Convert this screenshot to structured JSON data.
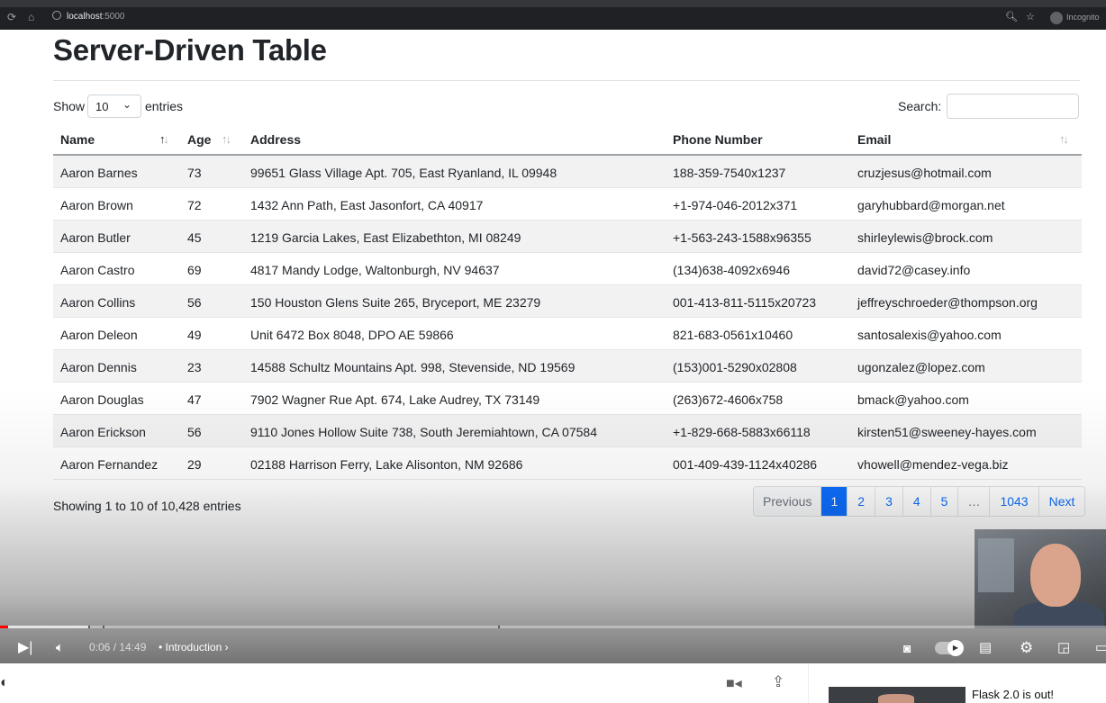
{
  "browser": {
    "url_host": "localhost",
    "url_port": ":5000",
    "incognito_label": "Incognito"
  },
  "page": {
    "title": "Server-Driven Table",
    "show_label": "Show",
    "page_size": "10",
    "entries_label": "entries",
    "search_label": "Search:",
    "search_value": ""
  },
  "table": {
    "columns": [
      "Name",
      "Age",
      "Address",
      "Phone Number",
      "Email"
    ],
    "sorted_column": "Name",
    "rows": [
      {
        "name": "Aaron Barnes",
        "age": "73",
        "address": "99651 Glass Village Apt. 705, East Ryanland, IL 09948",
        "phone": "188-359-7540x1237",
        "email": "cruzjesus@hotmail.com"
      },
      {
        "name": "Aaron Brown",
        "age": "72",
        "address": "1432 Ann Path, East Jasonfort, CA 40917",
        "phone": "+1-974-046-2012x371",
        "email": "garyhubbard@morgan.net"
      },
      {
        "name": "Aaron Butler",
        "age": "45",
        "address": "1219 Garcia Lakes, East Elizabethton, MI 08249",
        "phone": "+1-563-243-1588x96355",
        "email": "shirleylewis@brock.com"
      },
      {
        "name": "Aaron Castro",
        "age": "69",
        "address": "4817 Mandy Lodge, Waltonburgh, NV 94637",
        "phone": "(134)638-4092x6946",
        "email": "david72@casey.info"
      },
      {
        "name": "Aaron Collins",
        "age": "56",
        "address": "150 Houston Glens Suite 265, Bryceport, ME 23279",
        "phone": "001-413-811-5115x20723",
        "email": "jeffreyschroeder@thompson.org"
      },
      {
        "name": "Aaron Deleon",
        "age": "49",
        "address": "Unit 6472 Box 8048, DPO AE 59866",
        "phone": "821-683-0561x10460",
        "email": "santosalexis@yahoo.com"
      },
      {
        "name": "Aaron Dennis",
        "age": "23",
        "address": "14588 Schultz Mountains Apt. 998, Stevenside, ND 19569",
        "phone": "(153)001-5290x02808",
        "email": "ugonzalez@lopez.com"
      },
      {
        "name": "Aaron Douglas",
        "age": "47",
        "address": "7902 Wagner Rue Apt. 674, Lake Audrey, TX 73149",
        "phone": "(263)672-4606x758",
        "email": "bmack@yahoo.com"
      },
      {
        "name": "Aaron Erickson",
        "age": "56",
        "address": "9110 Jones Hollow Suite 738, South Jeremiahtown, CA 07584",
        "phone": "+1-829-668-5883x66118",
        "email": "kirsten51@sweeney-hayes.com"
      },
      {
        "name": "Aaron Fernandez",
        "age": "29",
        "address": "02188 Harrison Ferry, Lake Alisonton, NM 92686",
        "phone": "001-409-439-1124x40286",
        "email": "vhowell@mendez-vega.biz"
      }
    ]
  },
  "footer": {
    "info": "Showing 1 to 10 of 10,428 entries",
    "pagination": {
      "previous": "Previous",
      "pages": [
        "1",
        "2",
        "3",
        "4",
        "5"
      ],
      "ellipsis": "…",
      "last": "1043",
      "next": "Next",
      "active": "1"
    }
  },
  "video": {
    "time": "0:06 / 14:49",
    "chapter": "Introduction",
    "progress_fraction": 0.007
  },
  "below": {
    "recommended_title": "Flask 2.0 is out!"
  },
  "colors": {
    "accent": "#0d6efd",
    "progress": "#ff0000"
  }
}
